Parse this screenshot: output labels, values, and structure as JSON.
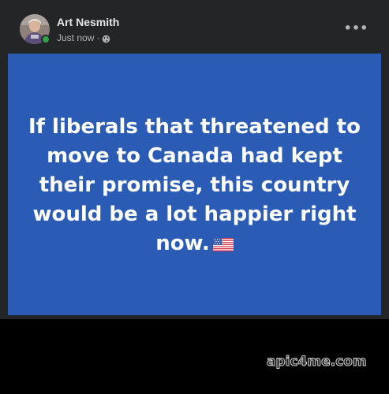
{
  "post": {
    "author": "Art Nesmith",
    "timestamp": "Just now",
    "separator": "·",
    "privacy_icon": "globe-icon",
    "more_icon": "more-options-icon",
    "text": "If liberals that threatened to move to Canada had kept their promise, this country would be a lot happier right now.",
    "emoji": "us-flag-icon",
    "background_color": "#2b5cb5",
    "online_status_color": "#31a24c"
  },
  "watermark": {
    "text": "apic4me.com"
  }
}
